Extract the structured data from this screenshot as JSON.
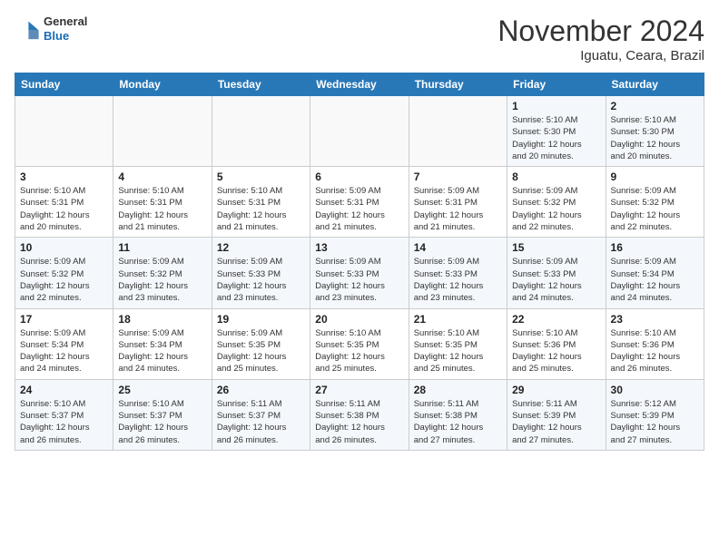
{
  "header": {
    "logo_line1": "General",
    "logo_line2": "Blue",
    "title": "November 2024",
    "subtitle": "Iguatu, Ceara, Brazil"
  },
  "calendar": {
    "days_of_week": [
      "Sunday",
      "Monday",
      "Tuesday",
      "Wednesday",
      "Thursday",
      "Friday",
      "Saturday"
    ],
    "weeks": [
      [
        {
          "day": "",
          "info": ""
        },
        {
          "day": "",
          "info": ""
        },
        {
          "day": "",
          "info": ""
        },
        {
          "day": "",
          "info": ""
        },
        {
          "day": "",
          "info": ""
        },
        {
          "day": "1",
          "info": "Sunrise: 5:10 AM\nSunset: 5:30 PM\nDaylight: 12 hours\nand 20 minutes."
        },
        {
          "day": "2",
          "info": "Sunrise: 5:10 AM\nSunset: 5:30 PM\nDaylight: 12 hours\nand 20 minutes."
        }
      ],
      [
        {
          "day": "3",
          "info": "Sunrise: 5:10 AM\nSunset: 5:31 PM\nDaylight: 12 hours\nand 20 minutes."
        },
        {
          "day": "4",
          "info": "Sunrise: 5:10 AM\nSunset: 5:31 PM\nDaylight: 12 hours\nand 21 minutes."
        },
        {
          "day": "5",
          "info": "Sunrise: 5:10 AM\nSunset: 5:31 PM\nDaylight: 12 hours\nand 21 minutes."
        },
        {
          "day": "6",
          "info": "Sunrise: 5:09 AM\nSunset: 5:31 PM\nDaylight: 12 hours\nand 21 minutes."
        },
        {
          "day": "7",
          "info": "Sunrise: 5:09 AM\nSunset: 5:31 PM\nDaylight: 12 hours\nand 21 minutes."
        },
        {
          "day": "8",
          "info": "Sunrise: 5:09 AM\nSunset: 5:32 PM\nDaylight: 12 hours\nand 22 minutes."
        },
        {
          "day": "9",
          "info": "Sunrise: 5:09 AM\nSunset: 5:32 PM\nDaylight: 12 hours\nand 22 minutes."
        }
      ],
      [
        {
          "day": "10",
          "info": "Sunrise: 5:09 AM\nSunset: 5:32 PM\nDaylight: 12 hours\nand 22 minutes."
        },
        {
          "day": "11",
          "info": "Sunrise: 5:09 AM\nSunset: 5:32 PM\nDaylight: 12 hours\nand 23 minutes."
        },
        {
          "day": "12",
          "info": "Sunrise: 5:09 AM\nSunset: 5:33 PM\nDaylight: 12 hours\nand 23 minutes."
        },
        {
          "day": "13",
          "info": "Sunrise: 5:09 AM\nSunset: 5:33 PM\nDaylight: 12 hours\nand 23 minutes."
        },
        {
          "day": "14",
          "info": "Sunrise: 5:09 AM\nSunset: 5:33 PM\nDaylight: 12 hours\nand 23 minutes."
        },
        {
          "day": "15",
          "info": "Sunrise: 5:09 AM\nSunset: 5:33 PM\nDaylight: 12 hours\nand 24 minutes."
        },
        {
          "day": "16",
          "info": "Sunrise: 5:09 AM\nSunset: 5:34 PM\nDaylight: 12 hours\nand 24 minutes."
        }
      ],
      [
        {
          "day": "17",
          "info": "Sunrise: 5:09 AM\nSunset: 5:34 PM\nDaylight: 12 hours\nand 24 minutes."
        },
        {
          "day": "18",
          "info": "Sunrise: 5:09 AM\nSunset: 5:34 PM\nDaylight: 12 hours\nand 24 minutes."
        },
        {
          "day": "19",
          "info": "Sunrise: 5:09 AM\nSunset: 5:35 PM\nDaylight: 12 hours\nand 25 minutes."
        },
        {
          "day": "20",
          "info": "Sunrise: 5:10 AM\nSunset: 5:35 PM\nDaylight: 12 hours\nand 25 minutes."
        },
        {
          "day": "21",
          "info": "Sunrise: 5:10 AM\nSunset: 5:35 PM\nDaylight: 12 hours\nand 25 minutes."
        },
        {
          "day": "22",
          "info": "Sunrise: 5:10 AM\nSunset: 5:36 PM\nDaylight: 12 hours\nand 25 minutes."
        },
        {
          "day": "23",
          "info": "Sunrise: 5:10 AM\nSunset: 5:36 PM\nDaylight: 12 hours\nand 26 minutes."
        }
      ],
      [
        {
          "day": "24",
          "info": "Sunrise: 5:10 AM\nSunset: 5:37 PM\nDaylight: 12 hours\nand 26 minutes."
        },
        {
          "day": "25",
          "info": "Sunrise: 5:10 AM\nSunset: 5:37 PM\nDaylight: 12 hours\nand 26 minutes."
        },
        {
          "day": "26",
          "info": "Sunrise: 5:11 AM\nSunset: 5:37 PM\nDaylight: 12 hours\nand 26 minutes."
        },
        {
          "day": "27",
          "info": "Sunrise: 5:11 AM\nSunset: 5:38 PM\nDaylight: 12 hours\nand 26 minutes."
        },
        {
          "day": "28",
          "info": "Sunrise: 5:11 AM\nSunset: 5:38 PM\nDaylight: 12 hours\nand 27 minutes."
        },
        {
          "day": "29",
          "info": "Sunrise: 5:11 AM\nSunset: 5:39 PM\nDaylight: 12 hours\nand 27 minutes."
        },
        {
          "day": "30",
          "info": "Sunrise: 5:12 AM\nSunset: 5:39 PM\nDaylight: 12 hours\nand 27 minutes."
        }
      ]
    ]
  }
}
